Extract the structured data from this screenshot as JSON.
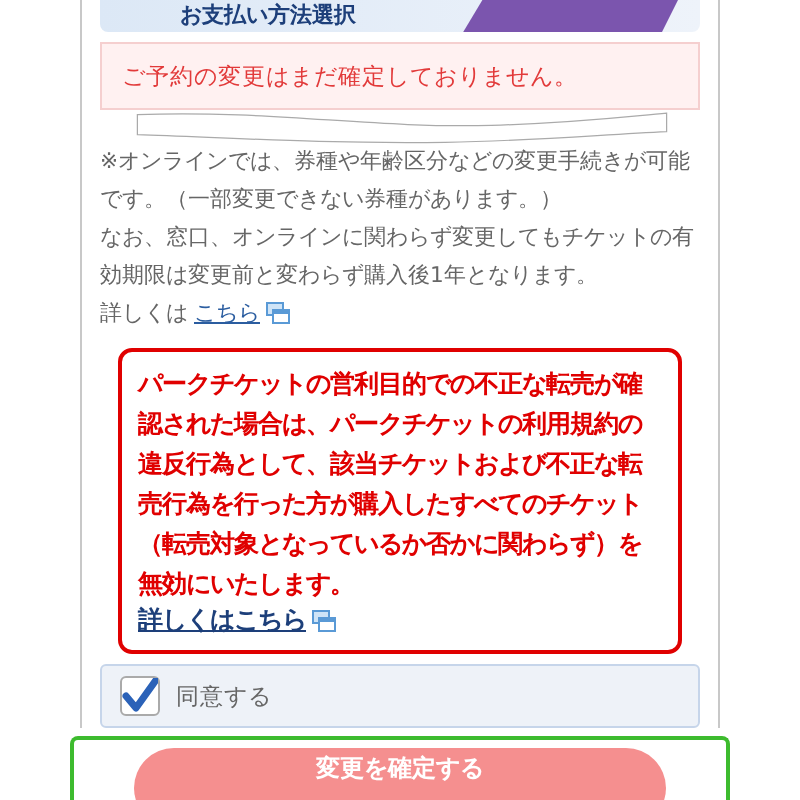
{
  "step_bar": {
    "label": "お支払い方法選択"
  },
  "notice": "ご予約の変更はまだ確定しておりません。",
  "info": {
    "paragraphs": [
      "※オンラインでは、券種や年齢区分などの変更手続きが可能です。（一部変更できない券種があります。）",
      "なお、窓口、オンラインに関わらず変更してもチケットの有効期限は変更前と変わらず購入後1年となります。"
    ],
    "more_prefix": "詳しくは",
    "more_link": "こちら"
  },
  "warning": {
    "text": "パークチケットの営利目的での不正な転売が確認された場合は、パークチケットの利用規約の違反行為として、該当チケットおよび不正な転売行為を行った方が購入したすべてのチケット（転売対象となっているか否かに関わらず）を無効にいたします。",
    "link": "詳しくはこちら"
  },
  "agree": {
    "label": "同意する",
    "checked": true
  },
  "submit": {
    "label": "変更を確定する"
  }
}
